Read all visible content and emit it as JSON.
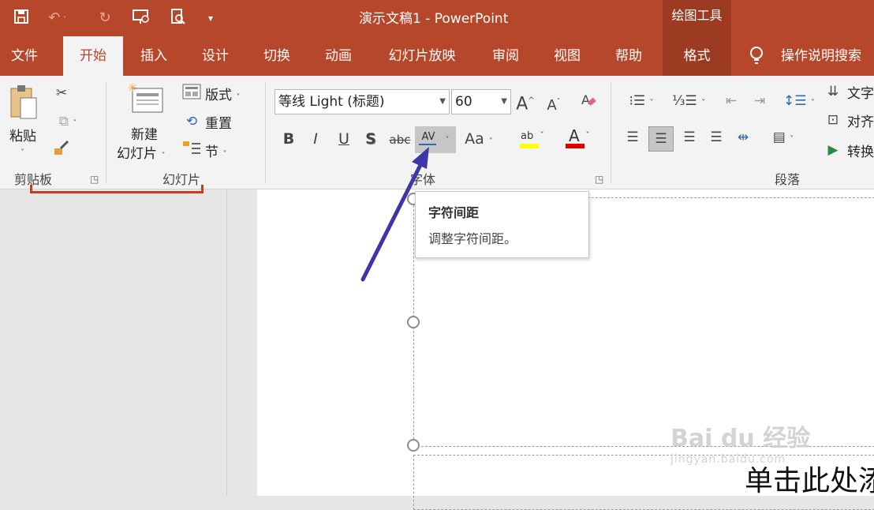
{
  "titlebar": {
    "title": "演示文稿1  -  PowerPoint",
    "context_group": "绘图工具"
  },
  "quick_access": {
    "icons": [
      "save-icon",
      "undo-icon",
      "redo-icon",
      "slideshow-from-beginning-icon",
      "print-preview-icon",
      "customize-qat-icon"
    ]
  },
  "tabs": [
    {
      "label": "文件"
    },
    {
      "label": "开始"
    },
    {
      "label": "插入"
    },
    {
      "label": "设计"
    },
    {
      "label": "切换"
    },
    {
      "label": "动画"
    },
    {
      "label": "幻灯片放映"
    },
    {
      "label": "审阅"
    },
    {
      "label": "视图"
    },
    {
      "label": "帮助"
    },
    {
      "label": "格式"
    }
  ],
  "tell_me": "操作说明搜索",
  "ribbon": {
    "clipboard": {
      "paste": "粘贴",
      "label": "剪贴板"
    },
    "slides": {
      "new_slide_line1": "新建",
      "new_slide_line2": "幻灯片",
      "layout": "版式",
      "reset": "重置",
      "section": "节",
      "label": "幻灯片"
    },
    "font": {
      "font_name": "等线 Light (标题)",
      "font_size": "60",
      "bold": "B",
      "italic": "I",
      "underline": "U",
      "shadow": "S",
      "strikethrough": "abc",
      "spacing": "AV",
      "change_case": "Aa",
      "grow": "A",
      "shrink": "A",
      "label": "字体"
    },
    "paragraph": {
      "text_direction": "文字",
      "align_text": "对齐",
      "convert": "转换",
      "label": "段落"
    }
  },
  "tooltip": {
    "title": "字符间距",
    "description": "调整字符间距。"
  },
  "slide": {
    "placeholder_text": "单击此处添"
  },
  "watermark": {
    "brand": "Bai du 经验",
    "url": "jingyan.baidu.com"
  },
  "colors": {
    "accent": "#b7472a",
    "context_tab": "#9c3b21",
    "arrow": "#3c36a8",
    "font_color_bar": "#e00000",
    "highlight_bar": "#ffff00"
  }
}
